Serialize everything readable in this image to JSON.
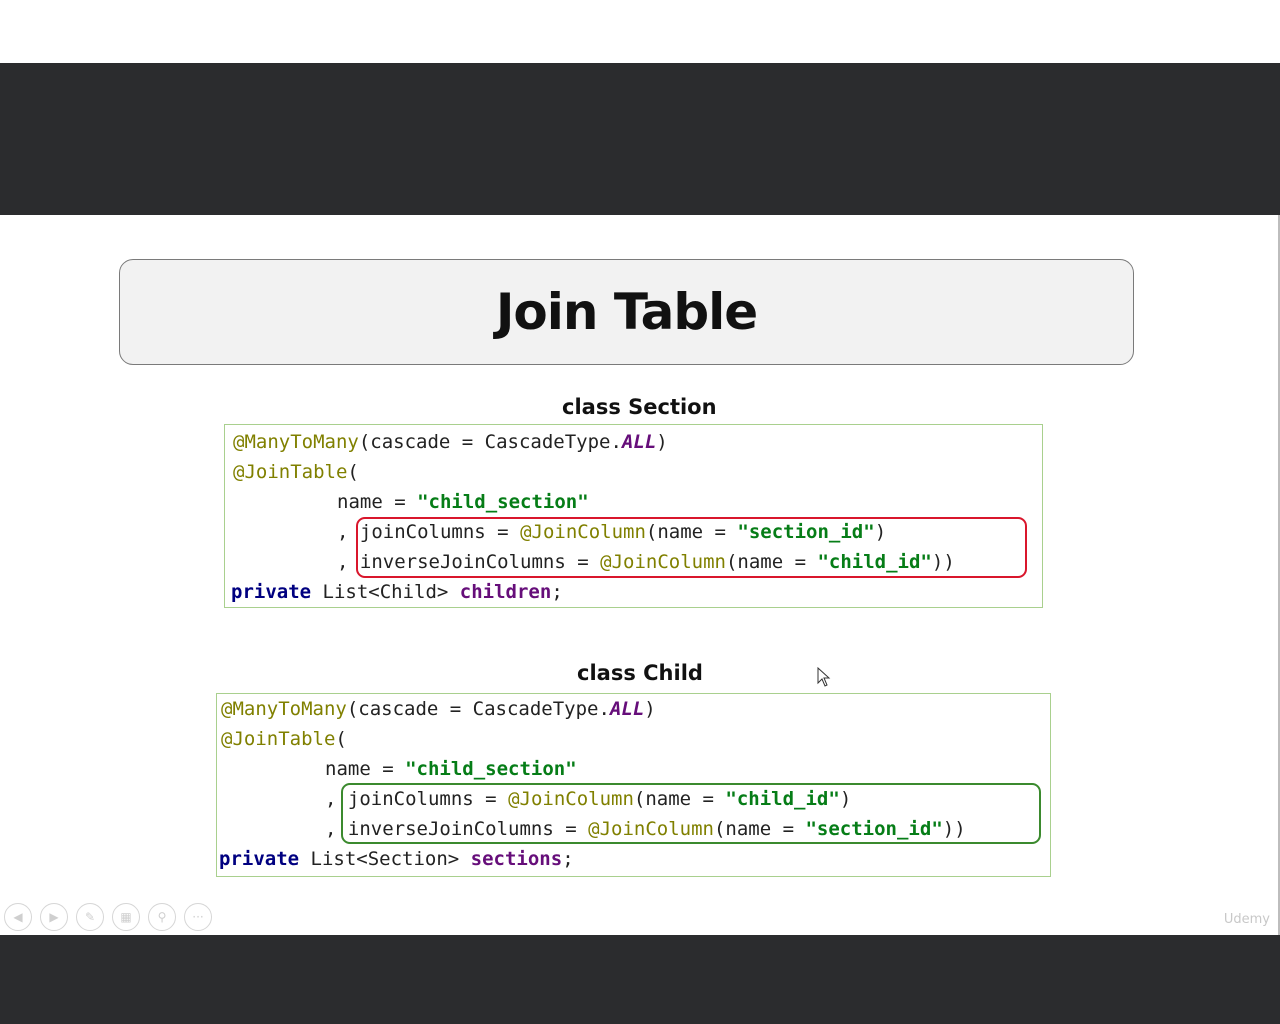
{
  "slide": {
    "title": "Join Table",
    "watermark": "Udemy"
  },
  "section": {
    "label": "class Section",
    "line1": {
      "anno1": "@ManyToMany",
      "t1": "(cascade = CascadeType.",
      "const": "ALL",
      "t2": ")"
    },
    "line2": {
      "anno": "@JoinTable",
      "t": "("
    },
    "line3": {
      "t": "name = ",
      "str": "\"child_section\""
    },
    "line4": {
      "comma": ",",
      "t1": "joinColumns = ",
      "anno": "@JoinColumn",
      "t2": "(name = ",
      "str": "\"section_id\"",
      "t3": ")"
    },
    "line5": {
      "comma": ",",
      "t1": "inverseJoinColumns = ",
      "anno": "@JoinColumn",
      "t2": "(name = ",
      "str": "\"child_id\"",
      "t3": "))"
    },
    "line6": {
      "kw": "private",
      "t": " List<Child> ",
      "fld": "children",
      "t2": ";"
    }
  },
  "child": {
    "label": "class Child",
    "line1": {
      "anno1": "@ManyToMany",
      "t1": "(cascade = CascadeType.",
      "const": "ALL",
      "t2": ")"
    },
    "line2": {
      "anno": "@JoinTable",
      "t": "("
    },
    "line3": {
      "t": "name = ",
      "str": "\"child_section\""
    },
    "line4": {
      "comma": ",",
      "t1": "joinColumns = ",
      "anno": "@JoinColumn",
      "t2": "(name = ",
      "str": "\"child_id\"",
      "t3": ")"
    },
    "line5": {
      "comma": ",",
      "t1": "inverseJoinColumns = ",
      "anno": "@JoinColumn",
      "t2": "(name = ",
      "str": "\"section_id\"",
      "t3": "))"
    },
    "line6": {
      "kw": "private",
      "t": " List<Section> ",
      "fld": "sections",
      "t2": ";"
    }
  },
  "controls": {
    "icons": [
      "previous-slide-icon",
      "next-slide-icon",
      "pen-icon",
      "slides-grid-icon",
      "zoom-icon",
      "more-options-icon"
    ]
  },
  "colors": {
    "highlight_red": "#d9162c",
    "highlight_green": "#3b8a2e",
    "annotation": "#808000",
    "string": "#067d17",
    "keyword": "#000080"
  }
}
